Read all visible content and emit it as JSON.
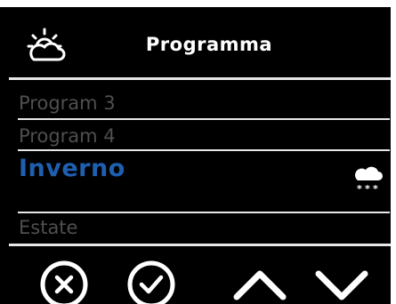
{
  "header": {
    "title": "Programma",
    "icon": "sun-cloud-icon"
  },
  "program_list": {
    "items": [
      {
        "label": "Program 3",
        "selected": false
      },
      {
        "label": "Program 4",
        "selected": false
      },
      {
        "label": "Inverno",
        "selected": true,
        "icon": "snow-cloud-icon"
      },
      {
        "label": "Estate",
        "selected": false
      }
    ]
  },
  "footer": {
    "buttons": [
      {
        "name": "cancel",
        "icon": "close-circle-icon"
      },
      {
        "name": "confirm",
        "icon": "check-circle-icon"
      },
      {
        "name": "up",
        "icon": "chevron-up-icon"
      },
      {
        "name": "down",
        "icon": "chevron-down-icon"
      }
    ]
  },
  "colors": {
    "background": "#000000",
    "text": "#ffffff",
    "inactive_text": "#4f4f4f",
    "selected_text": "#1f5fb0",
    "divider": "#e8e8e8"
  }
}
